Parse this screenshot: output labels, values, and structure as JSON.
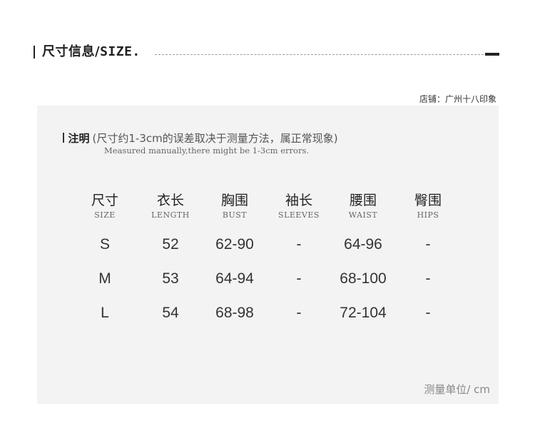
{
  "header": {
    "title_zh": "尺寸信息",
    "title_sep": "/",
    "title_en": "SIZE."
  },
  "store_label": "店铺：广州十八印象",
  "note": {
    "label": "注明",
    "text": "(尺寸约1-3cm的误差取决于测量方法，属正常现象)",
    "text_en": "Measured manually,there might be 1-3cm errors."
  },
  "table": {
    "columns": [
      {
        "zh": "尺寸",
        "en": "SIZE"
      },
      {
        "zh": "衣长",
        "en": "LENGTH"
      },
      {
        "zh": "胸围",
        "en": "BUST"
      },
      {
        "zh": "袖长",
        "en": "SLEEVES"
      },
      {
        "zh": "腰围",
        "en": "WAIST"
      },
      {
        "zh": "臀围",
        "en": "HIPS"
      }
    ],
    "rows": [
      [
        "S",
        "52",
        "62-90",
        "-",
        "64-96",
        "-"
      ],
      [
        "M",
        "53",
        "64-94",
        "-",
        "68-100",
        "-"
      ],
      [
        "L",
        "54",
        "68-98",
        "-",
        "72-104",
        "-"
      ]
    ]
  },
  "unit_label": "测量单位/ cm"
}
